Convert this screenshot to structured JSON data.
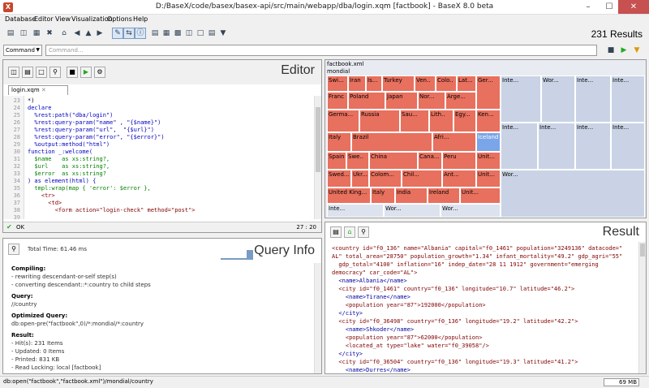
{
  "window": {
    "title": "D:/BaseX/code/basex/basex-api/src/main/webapp/dba/login.xqm [factbook] - BaseX 8.0 beta",
    "icon_label": "X"
  },
  "menu": [
    "Database",
    "Editor",
    "View",
    "Visualization",
    "Options",
    "Help"
  ],
  "toolbar": {
    "results": "231 Results"
  },
  "command": {
    "mode": "Command",
    "placeholder": "Command..."
  },
  "editor": {
    "title": "Editor",
    "tab": "login.xqm",
    "lines": [
      "23",
      "24",
      "25",
      "26",
      "27",
      "28",
      "29",
      "30",
      "31",
      "32",
      "33",
      "34",
      "35",
      "36",
      "37",
      "38",
      "39"
    ],
    "code": [
      "*)",
      "declare",
      "  %rest:path(\"dba/login\")",
      "  %rest:query-param(\"name\" , \"{$name}\")",
      "  %rest:query-param(\"url\",  \"{$url}\")",
      "  %rest:query-param(\"error\", \"{$error}\")",
      "  %output:method(\"html\")",
      "function _:welcome(",
      "  $name   as xs:string?,",
      "  $url    as xs:string?,",
      "  $error  as xs:string?",
      ") as element(html) {",
      "  tmpl:wrap(map { 'error': $error },",
      "    <tr>",
      "      <td>",
      "        <form action=\"login-check\" method=\"post\">",
      ""
    ],
    "status": "OK",
    "position": "27 : 20"
  },
  "queryinfo": {
    "title": "Query Info",
    "total_time": "Total Time: 61.46 ms",
    "compiling_label": "Compiling:",
    "compiling": [
      "- rewriting descendant-or-self step(s)",
      "- converting descendant::*:country to child steps"
    ],
    "query_label": "Query:",
    "query": "//country",
    "optimized_label": "Optimized Query:",
    "optimized": "db:open-pre(\"factbook\",0)/*:mondial/*:country",
    "result_label": "Result:",
    "result": [
      "- Hit(s): 231 Items",
      "- Updated: 0 Items",
      "- Printed: 831 KB",
      "- Read Locking: local [factbook]"
    ]
  },
  "map": {
    "file": "factbook.xml",
    "root": "mondial",
    "cells": [
      "Swi...",
      "Iran",
      "Is...",
      "Turkey",
      "Ven..",
      "Colo..",
      "Lat...",
      "Franc",
      "Poland",
      "Japan",
      "Nor...",
      "Arge...",
      "Ger...",
      "Germa...",
      "Russia",
      "Sau...",
      "Lith..",
      "Egy...",
      "Ken...",
      "Italy",
      "Brazil",
      "Afri...",
      "Iceland",
      "Spain",
      "Swe..",
      "China",
      "Cana...",
      "Peru",
      "Unit...",
      "Swed...",
      "Ukr...",
      "Colom...",
      "Chil...",
      "Ant...",
      "Unit...",
      "United King...",
      "Italy",
      "India",
      "Ireland",
      "Unit...",
      "Inte...",
      "Wor...",
      "Wor..."
    ],
    "blue_cells": [
      "Inte...",
      "Wor...",
      "Inte...",
      "Inte...",
      "Inte...",
      "Inte...",
      "Inte...",
      "Inte...",
      "Wor..."
    ]
  },
  "result": {
    "title": "Result",
    "lines": [
      "<country id=\"f0_136\" name=\"Albania\" capital=\"f0_1461\" population=\"3249136\" datacode=\"",
      "AL\" total_area=\"28750\" population_growth=\"1.34\" infant_mortality=\"49.2\" gdp_agri=\"55\"",
      "  gdp_total=\"4100\" inflation=\"16\" indep_date=\"28 11 1912\" government=\"emerging",
      "democracy\" car_code=\"AL\">",
      "  <name>Albania</name>",
      "  <city id=\"f0_1461\" country=\"f0_136\" longitude=\"10.7\" latitude=\"46.2\">",
      "    <name>Tirane</name>",
      "    <population year=\"87\">192000</population>",
      "  </city>",
      "  <city id=\"f0_36498\" country=\"f0_136\" longitude=\"19.2\" latitude=\"42.2\">",
      "    <name>Shkoder</name>",
      "    <population year=\"87\">62000</population>",
      "    <located_at type=\"lake\" water=\"f0_39058\"/>",
      "  </city>",
      "  <city id=\"f0_36504\" country=\"f0_136\" longitude=\"19.3\" latitude=\"41.2\">",
      "    <name>Durres</name>"
    ]
  },
  "statusbar": {
    "path": "db:open(\"factbook\",\"factbook.xml\")/mondial/country",
    "memory": "69 MB"
  }
}
